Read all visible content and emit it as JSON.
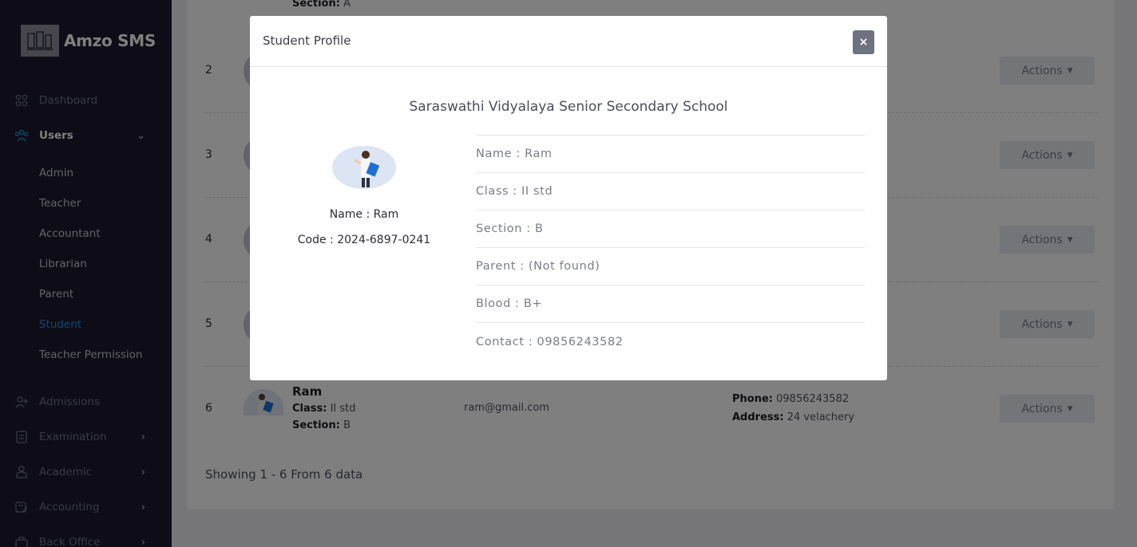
{
  "brand": {
    "name": "Amzo SMS"
  },
  "sidebar": {
    "items": [
      {
        "label": "Dashboard",
        "icon": "grid-icon"
      },
      {
        "label": "Users",
        "icon": "users-icon"
      },
      {
        "label": "Admissions",
        "icon": "user-plus-icon"
      },
      {
        "label": "Examination",
        "icon": "document-icon"
      },
      {
        "label": "Academic",
        "icon": "academic-icon"
      },
      {
        "label": "Accounting",
        "icon": "accounting-icon"
      },
      {
        "label": "Back Office",
        "icon": "briefcase-icon"
      }
    ],
    "users_sub": [
      "Admin",
      "Teacher",
      "Accountant",
      "Librarian",
      "Parent",
      "Student",
      "Teacher Permission"
    ]
  },
  "table": {
    "top_fragment": {
      "label": "Section:",
      "value": "A"
    },
    "rows": [
      {
        "num": "2",
        "action": "Actions"
      },
      {
        "num": "3",
        "action": "Actions"
      },
      {
        "num": "4",
        "action": "Actions"
      },
      {
        "num": "5",
        "action": "Actions"
      },
      {
        "num": "6",
        "action": "Actions"
      }
    ],
    "last_row": {
      "name": "Ram",
      "class_label": "Class:",
      "class_value": "II std",
      "section_label": "Section:",
      "section_value": "B",
      "email": "ram@gmail.com",
      "phone_label": "Phone:",
      "phone_value": "09856243582",
      "address_label": "Address:",
      "address_value": "24 velachery"
    },
    "footer": "Showing 1 - 6 From 6 data"
  },
  "modal": {
    "title": "Student Profile",
    "close": "×",
    "school": "Saraswathi Vidyalaya Senior Secondary School",
    "name_line": "Name : Ram",
    "code_line": "Code : 2024-6897-0241",
    "details": [
      "Name : Ram",
      "Class : II std",
      "Section : B",
      "Parent : (Not found)",
      "Blood : B+",
      "Contact : 09856243582"
    ]
  },
  "colors": {
    "sidebar": "#1c1b2e",
    "active_link": "#1e8fe1",
    "overlay": "rgba(0,0,0,0.5)"
  }
}
